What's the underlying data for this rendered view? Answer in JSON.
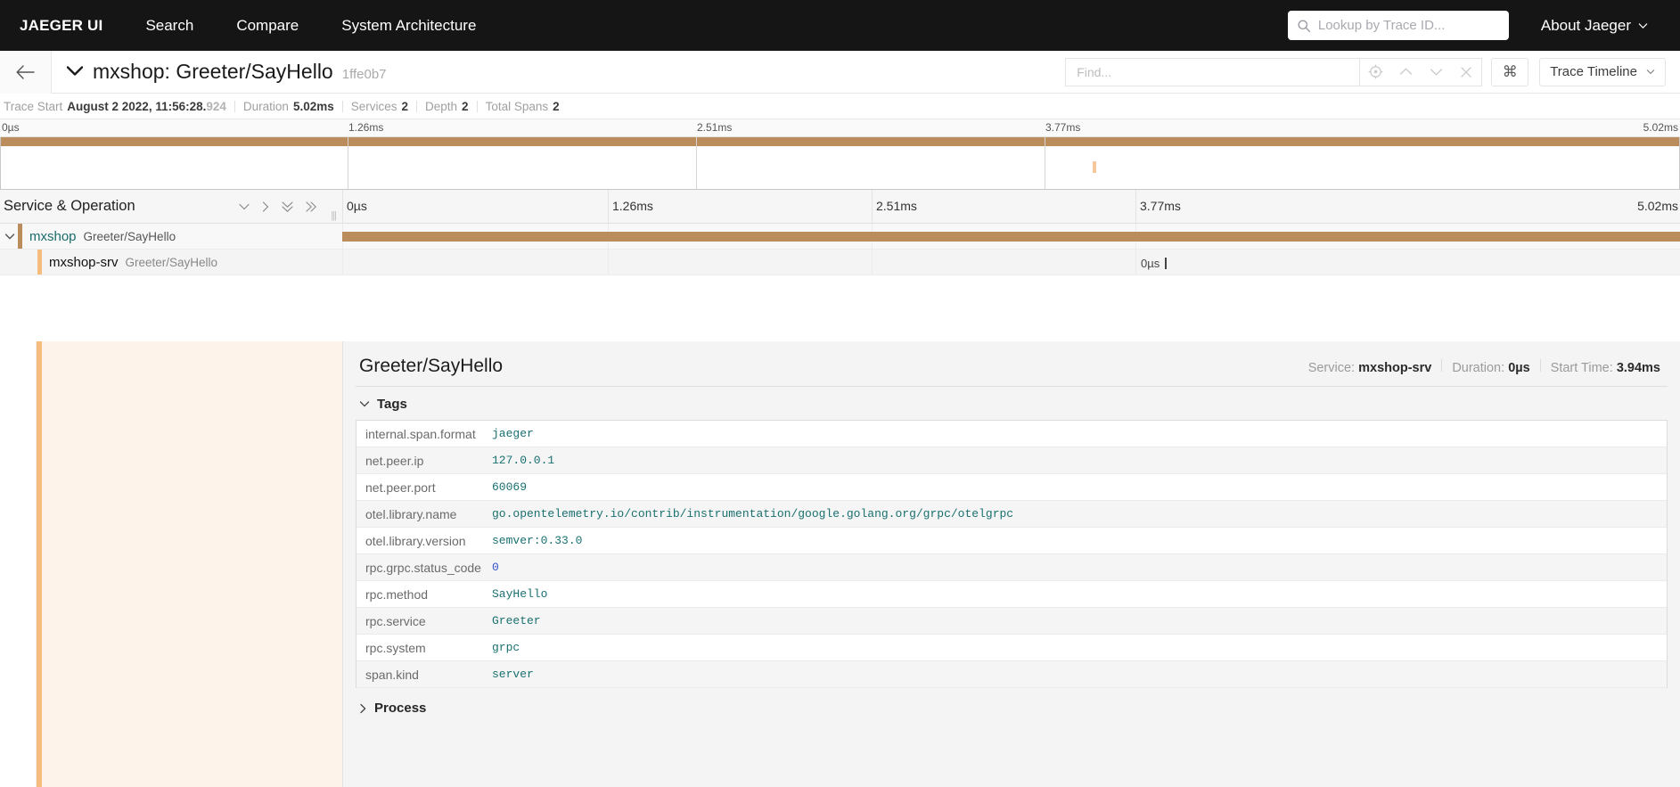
{
  "topnav": {
    "brand": "JAEGER UI",
    "links": [
      {
        "label": "Search"
      },
      {
        "label": "Compare"
      },
      {
        "label": "System Architecture"
      }
    ],
    "lookup_placeholder": "Lookup by Trace ID...",
    "about_label": "About Jaeger"
  },
  "trace_header": {
    "title": "mxshop: Greeter/SayHello",
    "trace_id": "1ffe0b7",
    "find_placeholder": "Find...",
    "kbd_label": "⌘",
    "view_label": "Trace Timeline"
  },
  "meta": {
    "trace_start_label": "Trace Start",
    "trace_start_value": "August 2 2022, 11:56:28.",
    "trace_start_frac": "924",
    "duration_label": "Duration",
    "duration_value": "5.02ms",
    "services_label": "Services",
    "services_value": "2",
    "depth_label": "Depth",
    "depth_value": "2",
    "total_spans_label": "Total Spans",
    "total_spans_value": "2"
  },
  "minimap": {
    "ticks": [
      "0µs",
      "1.26ms",
      "2.51ms",
      "3.77ms",
      "5.02ms"
    ],
    "bar_color": "#bb8c5c",
    "span2_color": "#f5c79a"
  },
  "timeline": {
    "column_header": "Service & Operation",
    "ticks": [
      "0µs",
      "1.26ms",
      "2.51ms",
      "3.77ms",
      "5.02ms"
    ],
    "rows": [
      {
        "service": "mxshop",
        "operation": "Greeter/SayHello",
        "bar_color": "#bb8c5c",
        "duration_label": ""
      },
      {
        "service": "mxshop-srv",
        "operation": "Greeter/SayHello",
        "bar_color": "#f6bd7f",
        "duration_label": "0µs"
      }
    ]
  },
  "detail": {
    "title": "Greeter/SayHello",
    "service_label": "Service:",
    "service_value": "mxshop-srv",
    "duration_label": "Duration:",
    "duration_value": "0µs",
    "start_time_label": "Start Time:",
    "start_time_value": "3.94ms",
    "tags_section": "Tags",
    "process_section": "Process",
    "tags": [
      {
        "key": "internal.span.format",
        "value": "jaeger",
        "numeric": false
      },
      {
        "key": "net.peer.ip",
        "value": "127.0.0.1",
        "numeric": false
      },
      {
        "key": "net.peer.port",
        "value": "60069",
        "numeric": false
      },
      {
        "key": "otel.library.name",
        "value": "go.opentelemetry.io/contrib/instrumentation/google.golang.org/grpc/otelgrpc",
        "numeric": false
      },
      {
        "key": "otel.library.version",
        "value": "semver:0.33.0",
        "numeric": false
      },
      {
        "key": "rpc.grpc.status_code",
        "value": "0",
        "numeric": true
      },
      {
        "key": "rpc.method",
        "value": "SayHello",
        "numeric": false
      },
      {
        "key": "rpc.service",
        "value": "Greeter",
        "numeric": false
      },
      {
        "key": "rpc.system",
        "value": "grpc",
        "numeric": false
      },
      {
        "key": "span.kind",
        "value": "server",
        "numeric": false
      }
    ]
  }
}
